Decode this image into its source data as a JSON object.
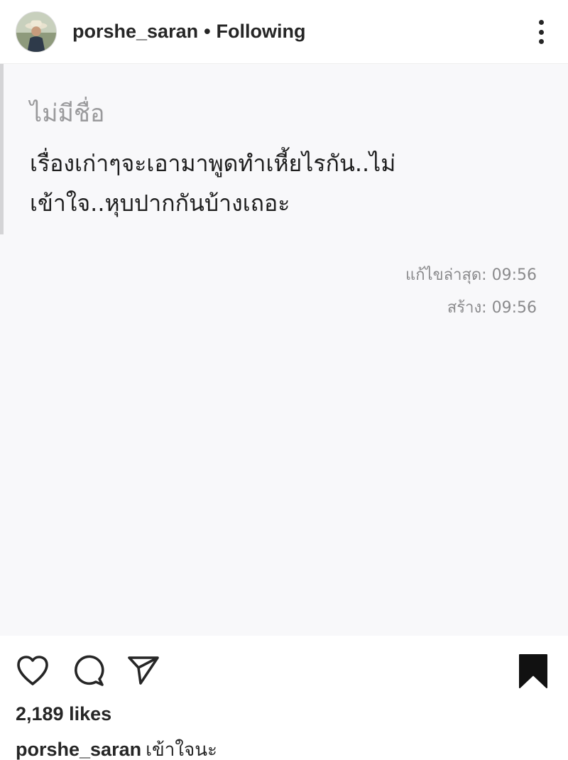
{
  "header": {
    "username": "porshe_saran",
    "separator": "•",
    "follow_status": "Following",
    "avatar_icon": "profile-avatar",
    "more_icon": "more-vertical-icon"
  },
  "note": {
    "title": "ไม่มีชื่อ",
    "body": "เรื่องเก่าๆจะเอามาพูดทำเหี้ยไรกัน..ไม่เข้าใจ..หุบปากกันบ้างเถอะ",
    "edited": "แก้ไขล่าสุด: 09:56",
    "created": "สร้าง: 09:56"
  },
  "actions": {
    "like_icon": "heart-icon",
    "comment_icon": "comment-icon",
    "share_icon": "send-icon",
    "save_icon": "bookmark-icon",
    "save_state": "saved"
  },
  "likes": "2,189 likes",
  "caption": {
    "username": "porshe_saran",
    "text": "เข้าใจนะ"
  },
  "colors": {
    "text": "#262626",
    "note_background": "#f8f8fa",
    "meta_text": "#8b8b8d",
    "title_text": "#9a9a9c"
  }
}
